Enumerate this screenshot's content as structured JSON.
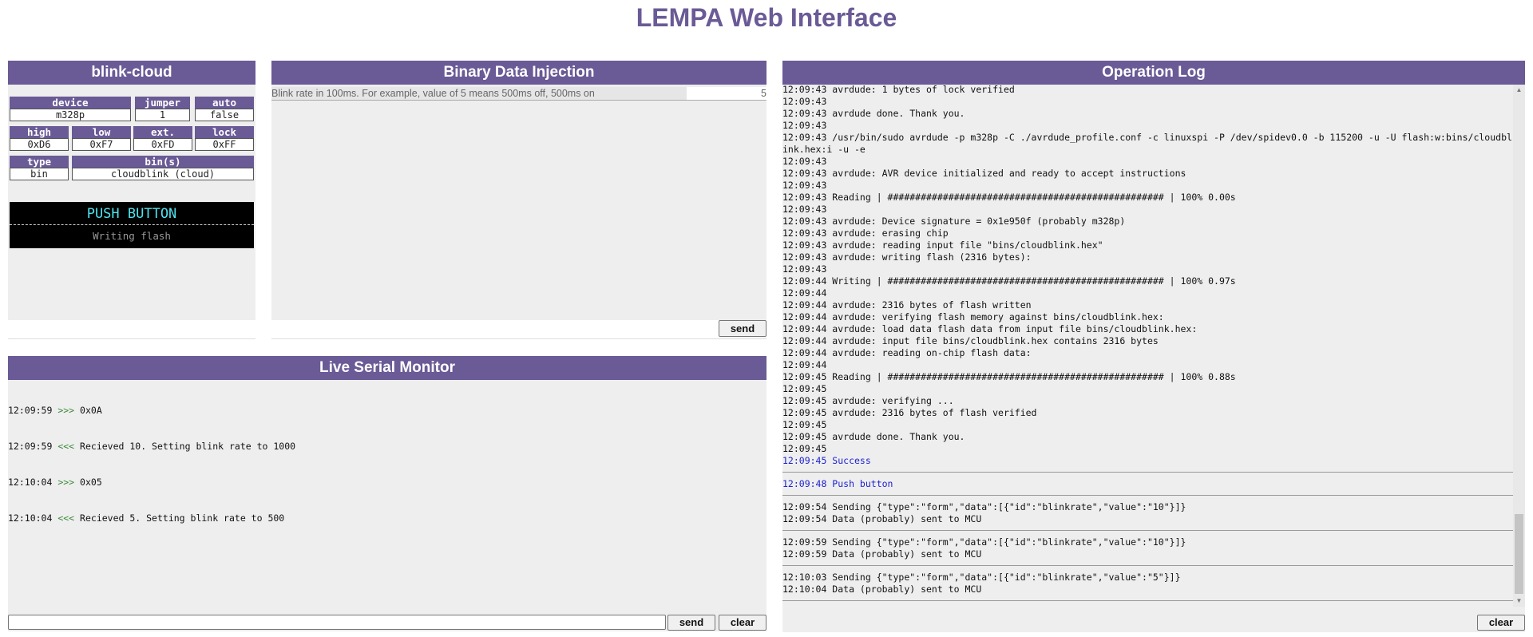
{
  "page_title": "LEMPA Web Interface",
  "device_panel": {
    "title": "blink-cloud",
    "fields": {
      "device": {
        "label": "device",
        "value": "m328p"
      },
      "jumper": {
        "label": "jumper",
        "value": "1"
      },
      "auto": {
        "label": "auto",
        "value": "false"
      },
      "high": {
        "label": "high",
        "value": "0xD6"
      },
      "low": {
        "label": "low",
        "value": "0xF7"
      },
      "ext": {
        "label": "ext.",
        "value": "0xFD"
      },
      "lock": {
        "label": "lock",
        "value": "0xFF"
      },
      "type": {
        "label": "type",
        "value": "bin"
      },
      "bins": {
        "label": "bin(s)",
        "value": "cloudblink (cloud)"
      }
    },
    "push_button": {
      "label": "PUSH BUTTON",
      "status": "Writing flash"
    }
  },
  "binary_injection": {
    "title": "Binary Data Injection",
    "field_description": "Blink rate in 100ms. For example, value of 5 means 500ms off, 500ms on",
    "field_value": "5",
    "send_label": "send"
  },
  "serial_monitor": {
    "title": "Live Serial Monitor",
    "lines": [
      {
        "time": "12:09:59",
        "dir": ">>>",
        "text": "0x0A"
      },
      {
        "time": "12:09:59",
        "dir": "<<<",
        "text": "Recieved 10. Setting blink rate to 1000"
      },
      {
        "time": "12:10:04",
        "dir": ">>>",
        "text": "0x05"
      },
      {
        "time": "12:10:04",
        "dir": "<<<",
        "text": "Recieved 5. Setting blink rate to 500"
      }
    ],
    "input_value": "",
    "send_label": "send",
    "clear_label": "clear"
  },
  "operation_log": {
    "title": "Operation Log",
    "clear_label": "clear",
    "lines": [
      {
        "text": "12:09:43 avrdude: 1 bytes of lock verified"
      },
      {
        "text": "12:09:43"
      },
      {
        "text": "12:09:43 avrdude done. Thank you."
      },
      {
        "text": "12:09:43"
      },
      {
        "text": "12:09:43 /usr/bin/sudo avrdude -p m328p -C ./avrdude_profile.conf -c linuxspi -P /dev/spidev0.0 -b 115200 -u -U flash:w:bins/cloudblink.hex:i -u -e"
      },
      {
        "text": "12:09:43"
      },
      {
        "text": "12:09:43 avrdude: AVR device initialized and ready to accept instructions"
      },
      {
        "text": "12:09:43"
      },
      {
        "text": "12:09:43 Reading | ################################################## | 100% 0.00s"
      },
      {
        "text": "12:09:43"
      },
      {
        "text": "12:09:43 avrdude: Device signature = 0x1e950f (probably m328p)"
      },
      {
        "text": "12:09:43 avrdude: erasing chip"
      },
      {
        "text": "12:09:43 avrdude: reading input file \"bins/cloudblink.hex\""
      },
      {
        "text": "12:09:43 avrdude: writing flash (2316 bytes):"
      },
      {
        "text": "12:09:43"
      },
      {
        "text": "12:09:44 Writing | ################################################## | 100% 0.97s"
      },
      {
        "text": "12:09:44"
      },
      {
        "text": "12:09:44 avrdude: 2316 bytes of flash written"
      },
      {
        "text": "12:09:44 avrdude: verifying flash memory against bins/cloudblink.hex:"
      },
      {
        "text": "12:09:44 avrdude: load data flash data from input file bins/cloudblink.hex:"
      },
      {
        "text": "12:09:44 avrdude: input file bins/cloudblink.hex contains 2316 bytes"
      },
      {
        "text": "12:09:44 avrdude: reading on-chip flash data:"
      },
      {
        "text": "12:09:44"
      },
      {
        "text": "12:09:45 Reading | ################################################## | 100% 0.88s"
      },
      {
        "text": "12:09:45"
      },
      {
        "text": "12:09:45 avrdude: verifying ..."
      },
      {
        "text": "12:09:45 avrdude: 2316 bytes of flash verified"
      },
      {
        "text": "12:09:45"
      },
      {
        "text": "12:09:45 avrdude done. Thank you."
      },
      {
        "text": "12:09:45"
      },
      {
        "text": "12:09:45 Success",
        "color": "blue"
      },
      {
        "separator": true
      },
      {
        "text": "12:09:48 Push button",
        "color": "blue"
      },
      {
        "separator": true
      },
      {
        "text": "12:09:54 Sending {\"type\":\"form\",\"data\":[{\"id\":\"blinkrate\",\"value\":\"10\"}]}"
      },
      {
        "text": "12:09:54 Data (probably) sent to MCU"
      },
      {
        "separator": true
      },
      {
        "text": "12:09:59 Sending {\"type\":\"form\",\"data\":[{\"id\":\"blinkrate\",\"value\":\"10\"}]}"
      },
      {
        "text": "12:09:59 Data (probably) sent to MCU"
      },
      {
        "separator": true
      },
      {
        "text": "12:10:03 Sending {\"type\":\"form\",\"data\":[{\"id\":\"blinkrate\",\"value\":\"5\"}]}"
      },
      {
        "text": "12:10:04 Data (probably) sent to MCU"
      },
      {
        "separator": true
      }
    ]
  },
  "colors": {
    "accent": "#6a5a96",
    "panel_bg": "#eeeeee",
    "log_highlight": "#1e22d0",
    "serial_arrow": "#3a8a3a",
    "push_text": "#4fe3ee"
  }
}
